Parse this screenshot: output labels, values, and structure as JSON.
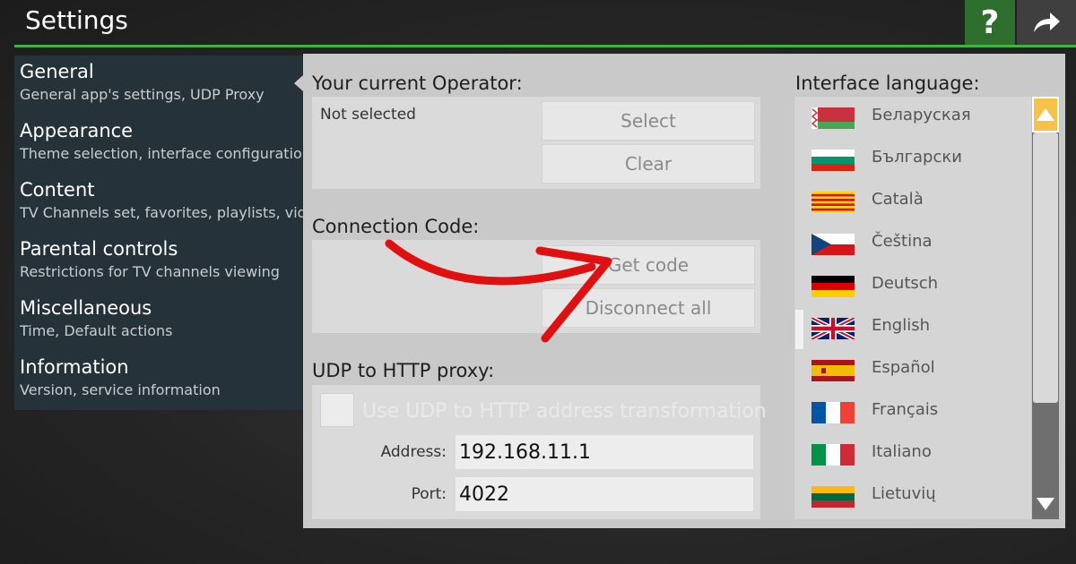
{
  "header": {
    "title": "Settings",
    "help_label": "?"
  },
  "nav": {
    "items": [
      {
        "title": "General",
        "subtitle": "General app's settings, UDP Proxy"
      },
      {
        "title": "Appearance",
        "subtitle": "Theme selection, interface configuration"
      },
      {
        "title": "Content",
        "subtitle": "TV Channels set, favorites, playlists, video"
      },
      {
        "title": "Parental controls",
        "subtitle": "Restrictions for TV channels viewing"
      },
      {
        "title": "Miscellaneous",
        "subtitle": "Time, Default actions"
      },
      {
        "title": "Information",
        "subtitle": "Version, service information"
      }
    ]
  },
  "operator": {
    "label": "Your current Operator:",
    "value": "Not selected",
    "select_label": "Select",
    "clear_label": "Clear"
  },
  "connection": {
    "label": "Connection Code:",
    "get_code_label": "Get code",
    "disconnect_label": "Disconnect all"
  },
  "proxy": {
    "label": "UDP to HTTP proxy:",
    "checkbox_label": "Use UDP to HTTP address transformation",
    "checked": false,
    "address_label": "Address:",
    "address_value": "192.168.11.1",
    "port_label": "Port:",
    "port_value": "4022"
  },
  "language": {
    "label": "Interface language:",
    "selected": "English",
    "items": [
      {
        "name": "Беларуская",
        "flag": "by-flag"
      },
      {
        "name": "Български",
        "flag": "bg-flag"
      },
      {
        "name": "Català",
        "flag": "catalan-flag"
      },
      {
        "name": "Čeština",
        "flag": "cz-flag"
      },
      {
        "name": "Deutsch",
        "flag": "de-flag"
      },
      {
        "name": "English",
        "flag": "uk-flag"
      },
      {
        "name": "Español",
        "flag": "es-flag"
      },
      {
        "name": "Français",
        "flag": "fr-flag"
      },
      {
        "name": "Italiano",
        "flag": "it-flag"
      },
      {
        "name": "Lietuvių",
        "flag": "lt-flag"
      }
    ]
  },
  "colors": {
    "accent": "#3fb43f",
    "nav_bg": "#25323a",
    "panel_bg": "#c9c9c9",
    "scroll_up": "#f6c24a",
    "annotation_arrow": "#e01010"
  }
}
